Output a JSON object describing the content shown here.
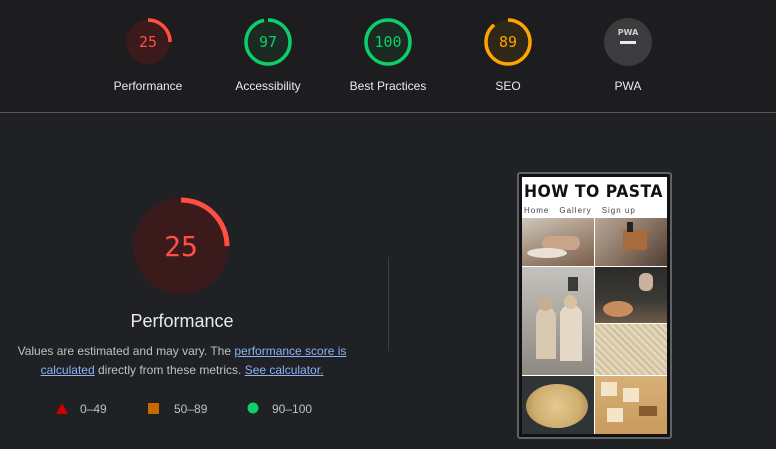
{
  "summary": [
    {
      "score": "25",
      "label": "Performance",
      "value": 0.25,
      "color": "#ff4e42",
      "bg": "#3a1a1b"
    },
    {
      "score": "97",
      "label": "Accessibility",
      "value": 0.97,
      "color": "#0cce6b",
      "bg": "#1b2a22"
    },
    {
      "score": "100",
      "label": "Best Practices",
      "value": 1.0,
      "color": "#0cce6b",
      "bg": "#1b2a22"
    },
    {
      "score": "89",
      "label": "SEO",
      "value": 0.89,
      "color": "#ffa400",
      "bg": "#2f2717"
    },
    {
      "label": "PWA",
      "badge": "PWA",
      "icon": "pwa-badge-icon"
    }
  ],
  "performance": {
    "score": "25",
    "value": 0.25,
    "title": "Performance",
    "color": "#ff4e42",
    "description_prefix": "Values are estimated and may vary. The ",
    "link_score": "performance score is calculated",
    "description_middle": " directly from these metrics. ",
    "link_calculator": "See calculator."
  },
  "legend": [
    {
      "range": "0–49",
      "shape": "triangle",
      "color": "#cc0000"
    },
    {
      "range": "50–89",
      "shape": "square",
      "color": "#c76a00"
    },
    {
      "range": "90–100",
      "shape": "circle",
      "color": "#0cce6b"
    }
  ],
  "screenshot": {
    "site_title": "HOW TO PASTA",
    "nav": [
      "Home",
      "Gallery",
      "Sign up"
    ]
  }
}
